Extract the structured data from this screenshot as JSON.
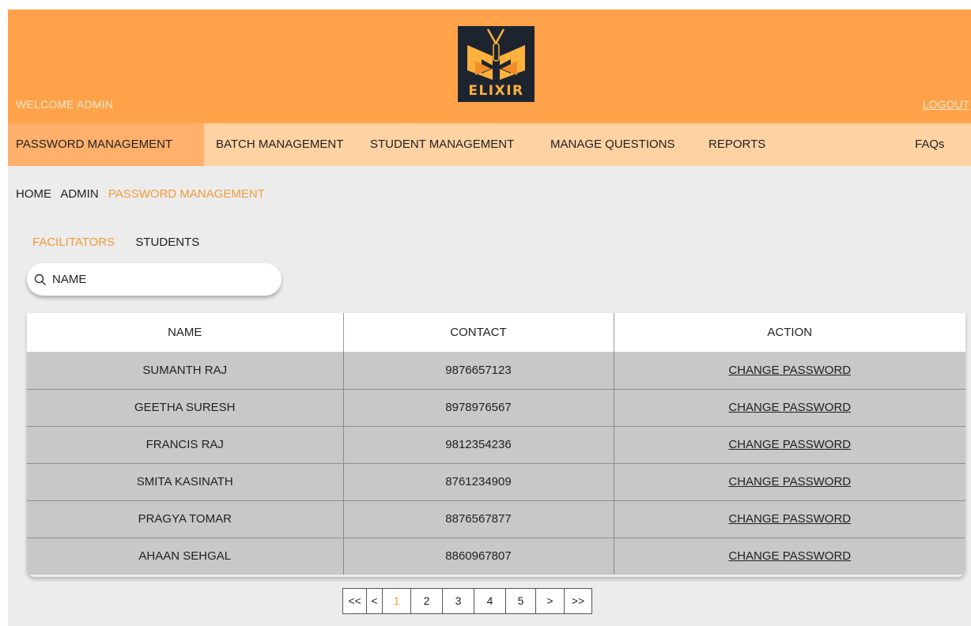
{
  "header": {
    "welcome": "WELCOME ADMIN",
    "logout": "LOGOUT",
    "logo_text": "ELIXIR",
    "bg_color": "#ffa24a"
  },
  "nav": {
    "items": [
      {
        "label": "PASSWORD MANAGEMENT",
        "active": true
      },
      {
        "label": "BATCH MANAGEMENT"
      },
      {
        "label": "STUDENT MANAGEMENT"
      },
      {
        "label": "MANAGE QUESTIONS"
      },
      {
        "label": "REPORTS"
      },
      {
        "label": "FAQs"
      }
    ]
  },
  "breadcrumb": [
    "HOME",
    "ADMIN",
    "PASSWORD MANAGEMENT"
  ],
  "subtabs": [
    {
      "label": "FACILITATORS",
      "active": true
    },
    {
      "label": "STUDENTS"
    }
  ],
  "search": {
    "placeholder": "NAME",
    "icon": "search-icon"
  },
  "table": {
    "headers": [
      "NAME",
      "CONTACT",
      "ACTION"
    ],
    "rows": [
      {
        "name": "SUMANTH RAJ",
        "contact": "9876657123",
        "action": "CHANGE PASSWORD"
      },
      {
        "name": "GEETHA SURESH",
        "contact": "8978976567",
        "action": "CHANGE PASSWORD"
      },
      {
        "name": "FRANCIS RAJ",
        "contact": "9812354236",
        "action": "CHANGE PASSWORD"
      },
      {
        "name": "SMITA KASINATH",
        "contact": "8761234909",
        "action": "CHANGE PASSWORD"
      },
      {
        "name": "PRAGYA TOMAR",
        "contact": "8876567877",
        "action": "CHANGE PASSWORD"
      },
      {
        "name": "AHAAN SEHGAL",
        "contact": "8860967807",
        "action": "CHANGE PASSWORD"
      }
    ]
  },
  "pagination": {
    "first": "<<",
    "prev": "<",
    "pages": [
      "1",
      "2",
      "3",
      "4",
      "5"
    ],
    "current": "1",
    "next": ">",
    "last": ">>"
  },
  "colors": {
    "accent": "#f39a3c",
    "nav_bg": "#ffd2a3",
    "nav_active": "#ffb06b"
  }
}
